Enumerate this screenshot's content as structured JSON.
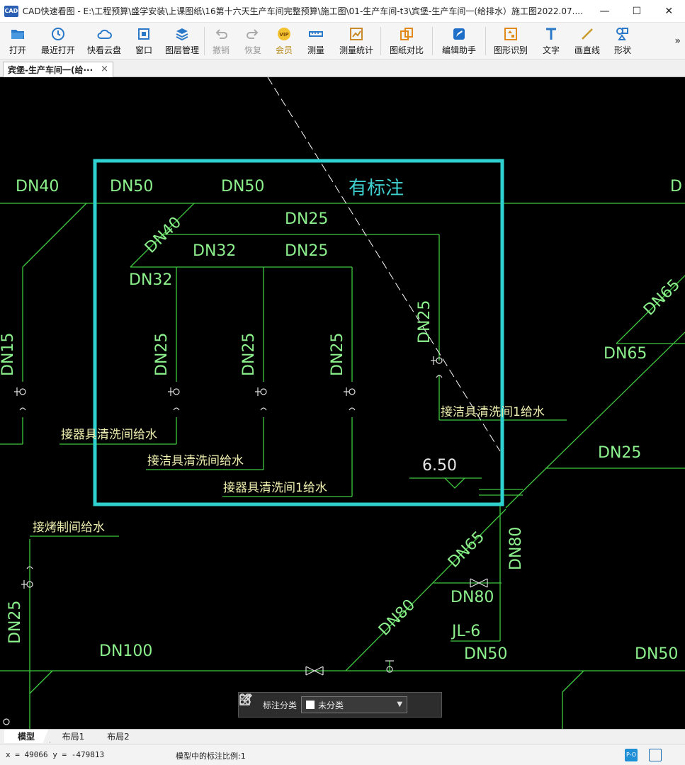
{
  "window": {
    "logo_text": "CAD",
    "title": "CAD快速看图 - E:\\工程预算\\盛学安装\\上课图纸\\16第十六天生产车间完整预算\\施工图\\01-生产车间-t3\\宾堡-生产车间一(给排水）施工图2022.07....",
    "minimize": "—",
    "maximize": "☐",
    "close": "✕"
  },
  "toolbar": {
    "open": "打开",
    "recent": "最近打开",
    "cloud": "快看云盘",
    "window": "窗口",
    "layers": "图层管理",
    "undo": "撤销",
    "redo": "恢复",
    "vip": "会员",
    "vip_badge": "VIP",
    "measure": "测量",
    "measure_stats": "测量统计",
    "compare": "图纸对比",
    "edit_assist": "编辑助手",
    "shape_recog": "图形识别",
    "text": "文字",
    "line": "画直线",
    "shape": "形状",
    "more": "»"
  },
  "tab": {
    "label": "宾堡-生产车间一(给···",
    "close": "×"
  },
  "drawing": {
    "markup_note": "有标注",
    "labels": {
      "dn40_left": "DN40",
      "dn50_a": "DN50",
      "dn50_b": "DN50",
      "dn_edge": "D",
      "dn40_diag": "DN40",
      "dn25_top": "DN25",
      "dn32": "DN32",
      "dn25_mid": "DN25",
      "dn32_b": "DN32",
      "dn15": "DN15",
      "dn25_v1": "DN25",
      "dn25_v2": "DN25",
      "dn25_v3": "DN25",
      "dn25_v4": "DN25",
      "dn65_diag": "DN65",
      "dn65": "DN65",
      "dn25_right": "DN25",
      "elev": "6.50",
      "dn65_b": "DN65",
      "dn80_v": "DN80",
      "dn80": "DN80",
      "dn80_diag": "DN80",
      "jl6": "JL-6",
      "dn25_left_v": "DN25",
      "dn100": "DN100",
      "dn50_c": "DN50",
      "dn50_d": "DN50"
    },
    "notes": {
      "n1": "接器具清洗间给水",
      "n2": "接洁具清洗间给水",
      "n3": "接器具清洗间1给水",
      "n4": "接洁具清洗间1给水",
      "n5": "接烤制间给水"
    }
  },
  "annotation_bar": {
    "label": "标注分类",
    "selected": "未分类"
  },
  "layout_tabs": {
    "model": "模型",
    "layout1": "布局1",
    "layout2": "布局2"
  },
  "status": {
    "coords": "x = 49066  y = -479813",
    "scale": "模型中的标注比例:1",
    "icon1": "P-O"
  },
  "colors": {
    "pipe": "#3fc83f",
    "markup": "#2fd0d0",
    "canvas": "#000000"
  }
}
